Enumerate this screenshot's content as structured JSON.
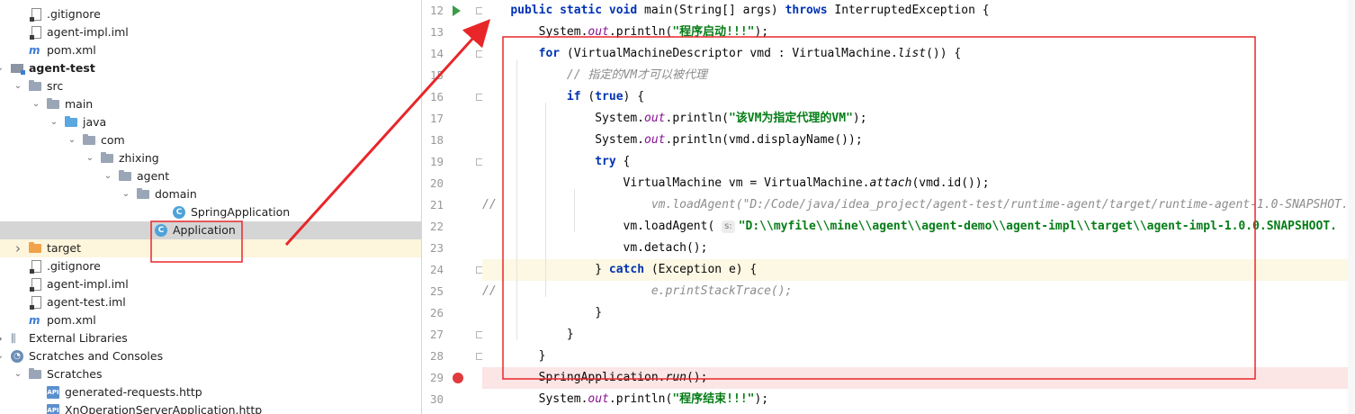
{
  "project_tree": {
    "items": [
      {
        "label": ".gitignore",
        "icon": "gitignore-file-icon",
        "indent": 2,
        "arrow": "",
        "bold": false
      },
      {
        "label": "agent-impl.iml",
        "icon": "iml-file-icon",
        "indent": 2,
        "arrow": "",
        "bold": false
      },
      {
        "label": "pom.xml",
        "icon": "maven-icon",
        "indent": 2,
        "arrow": "",
        "bold": false
      },
      {
        "label": "agent-test",
        "icon": "module-icon",
        "indent": 1,
        "arrow": "down",
        "bold": true
      },
      {
        "label": "src",
        "icon": "folder-icon",
        "indent": 2,
        "arrow": "down",
        "bold": false
      },
      {
        "label": "main",
        "icon": "folder-icon",
        "indent": 3,
        "arrow": "down",
        "bold": false
      },
      {
        "label": "java",
        "icon": "source-folder-icon",
        "indent": 4,
        "arrow": "down",
        "bold": false
      },
      {
        "label": "com",
        "icon": "package-icon",
        "indent": 5,
        "arrow": "down",
        "bold": false
      },
      {
        "label": "zhixing",
        "icon": "package-icon",
        "indent": 6,
        "arrow": "down",
        "bold": false
      },
      {
        "label": "agent",
        "icon": "package-icon",
        "indent": 7,
        "arrow": "down",
        "bold": false
      },
      {
        "label": "domain",
        "icon": "package-icon",
        "indent": 8,
        "arrow": "down",
        "bold": false
      },
      {
        "label": "SpringApplication",
        "icon": "class-icon",
        "indent": 10,
        "arrow": "",
        "bold": false
      },
      {
        "label": "Application",
        "icon": "class-icon",
        "indent": 9,
        "arrow": "",
        "bold": false,
        "selected": true
      },
      {
        "label": "target",
        "icon": "excluded-folder-icon",
        "indent": 2,
        "arrow": "right",
        "bold": false,
        "highlight": true
      },
      {
        "label": ".gitignore",
        "icon": "gitignore-file-icon",
        "indent": 2,
        "arrow": "",
        "bold": false
      },
      {
        "label": "agent-impl.iml",
        "icon": "iml-file-icon",
        "indent": 2,
        "arrow": "",
        "bold": false
      },
      {
        "label": "agent-test.iml",
        "icon": "iml-file-icon",
        "indent": 2,
        "arrow": "",
        "bold": false
      },
      {
        "label": "pom.xml",
        "icon": "maven-icon",
        "indent": 2,
        "arrow": "",
        "bold": false
      },
      {
        "label": "External Libraries",
        "icon": "library-icon",
        "indent": 1,
        "arrow": "right",
        "bold": false
      },
      {
        "label": "Scratches and Consoles",
        "icon": "scratch-icon",
        "indent": 1,
        "arrow": "down",
        "bold": false
      },
      {
        "label": "Scratches",
        "icon": "folder-icon",
        "indent": 2,
        "arrow": "down",
        "bold": false
      },
      {
        "label": "generated-requests.http",
        "icon": "api-file-icon",
        "indent": 3,
        "arrow": "",
        "bold": false
      },
      {
        "label": "XnOperationServerApplication.http",
        "icon": "api-file-icon",
        "indent": 3,
        "arrow": "",
        "bold": false
      }
    ]
  },
  "editor": {
    "lines": [
      {
        "num": "12",
        "run": true,
        "breakpoint": false,
        "fold": true,
        "bg": "",
        "tokens": [
          [
            "    ",
            ""
          ],
          [
            "public static void",
            "kw"
          ],
          [
            " main(String[] args) ",
            ""
          ],
          [
            "throws",
            "kw"
          ],
          [
            " InterruptedException {",
            ""
          ]
        ]
      },
      {
        "num": "13",
        "run": false,
        "breakpoint": false,
        "fold": false,
        "bg": "",
        "tokens": [
          [
            "        System.",
            ""
          ],
          [
            "out",
            "fld"
          ],
          [
            ".println(",
            ""
          ],
          [
            "\"程序启动!!!\"",
            "str"
          ],
          [
            ");",
            ""
          ]
        ]
      },
      {
        "num": "14",
        "run": false,
        "breakpoint": false,
        "fold": true,
        "bg": "",
        "tokens": [
          [
            "        ",
            ""
          ],
          [
            "for",
            "kw"
          ],
          [
            " (VirtualMachineDescriptor vmd : VirtualMachine.",
            ""
          ],
          [
            "list",
            "ital"
          ],
          [
            "()) {",
            ""
          ]
        ]
      },
      {
        "num": "15",
        "run": false,
        "breakpoint": false,
        "fold": false,
        "bg": "",
        "tokens": [
          [
            "            ",
            ""
          ],
          [
            "// 指定的VM才可以被代理",
            "cmt"
          ]
        ]
      },
      {
        "num": "16",
        "run": false,
        "breakpoint": false,
        "fold": true,
        "bg": "",
        "tokens": [
          [
            "            ",
            ""
          ],
          [
            "if",
            "kw"
          ],
          [
            " (",
            ""
          ],
          [
            "true",
            "kw"
          ],
          [
            ") {",
            ""
          ]
        ]
      },
      {
        "num": "17",
        "run": false,
        "breakpoint": false,
        "fold": false,
        "bg": "",
        "tokens": [
          [
            "                System.",
            ""
          ],
          [
            "out",
            "fld"
          ],
          [
            ".println(",
            ""
          ],
          [
            "\"该VM为指定代理的VM\"",
            "str"
          ],
          [
            ");",
            ""
          ]
        ]
      },
      {
        "num": "18",
        "run": false,
        "breakpoint": false,
        "fold": false,
        "bg": "",
        "tokens": [
          [
            "                System.",
            ""
          ],
          [
            "out",
            "fld"
          ],
          [
            ".println(vmd.displayName());",
            ""
          ]
        ]
      },
      {
        "num": "19",
        "run": false,
        "breakpoint": false,
        "fold": true,
        "bg": "",
        "tokens": [
          [
            "                ",
            ""
          ],
          [
            "try",
            "kw"
          ],
          [
            " {",
            ""
          ]
        ]
      },
      {
        "num": "20",
        "run": false,
        "breakpoint": false,
        "fold": false,
        "bg": "",
        "tokens": [
          [
            "                    VirtualMachine vm = VirtualMachine.",
            ""
          ],
          [
            "attach",
            "ital"
          ],
          [
            "(vmd.id());",
            ""
          ]
        ]
      },
      {
        "num": "21",
        "run": false,
        "breakpoint": false,
        "fold": false,
        "bg": "",
        "tokens": [
          [
            "//",
            "cmt"
          ],
          [
            "                      vm.loadAgent(\"D:/Code/java/idea_project/agent-test/runtime-agent/target/runtime-agent-1.0-SNAPSHOT.",
            "cmt"
          ]
        ]
      },
      {
        "num": "22",
        "run": false,
        "breakpoint": false,
        "fold": false,
        "bg": "",
        "tokens": [
          [
            "                    vm.loadAgent( ",
            ""
          ],
          [
            "s:",
            "hint"
          ],
          [
            "\"D:\\\\myfile\\\\mine\\\\agent\\\\agent-demo\\\\agent-impl\\\\target\\\\agent-impl-1.0.0.SNAPSHOOT.",
            "str"
          ]
        ]
      },
      {
        "num": "23",
        "run": false,
        "breakpoint": false,
        "fold": false,
        "bg": "",
        "tokens": [
          [
            "                    vm.detach();",
            ""
          ]
        ]
      },
      {
        "num": "24",
        "run": false,
        "breakpoint": false,
        "fold": true,
        "bg": "yellow",
        "tokens": [
          [
            "                } ",
            ""
          ],
          [
            "catch",
            "kw"
          ],
          [
            " (Exception e) {",
            ""
          ]
        ]
      },
      {
        "num": "25",
        "run": false,
        "breakpoint": false,
        "fold": false,
        "bg": "",
        "tokens": [
          [
            "//",
            "cmt"
          ],
          [
            "                      e.printStackTrace();",
            "cmt"
          ]
        ]
      },
      {
        "num": "26",
        "run": false,
        "breakpoint": false,
        "fold": false,
        "bg": "",
        "tokens": [
          [
            "                }",
            ""
          ]
        ]
      },
      {
        "num": "27",
        "run": false,
        "breakpoint": false,
        "fold": true,
        "bg": "",
        "tokens": [
          [
            "            }",
            ""
          ]
        ]
      },
      {
        "num": "28",
        "run": false,
        "breakpoint": false,
        "fold": true,
        "bg": "",
        "tokens": [
          [
            "        }",
            ""
          ]
        ]
      },
      {
        "num": "29",
        "run": false,
        "breakpoint": true,
        "fold": false,
        "bg": "red",
        "tokens": [
          [
            "        SpringApplication.",
            ""
          ],
          [
            "run",
            "ital"
          ],
          [
            "();",
            ""
          ]
        ]
      },
      {
        "num": "30",
        "run": false,
        "breakpoint": false,
        "fold": false,
        "bg": "",
        "tokens": [
          [
            "        System.",
            ""
          ],
          [
            "out",
            "fld"
          ],
          [
            ".println(",
            ""
          ],
          [
            "\"程序结束!!!\"",
            "str"
          ],
          [
            ");",
            ""
          ]
        ]
      }
    ]
  },
  "colors": {
    "annotation_red": "#e8262a",
    "keyword": "#0033b3",
    "string": "#067d17",
    "field": "#871094",
    "comment": "#8c8c8c"
  }
}
